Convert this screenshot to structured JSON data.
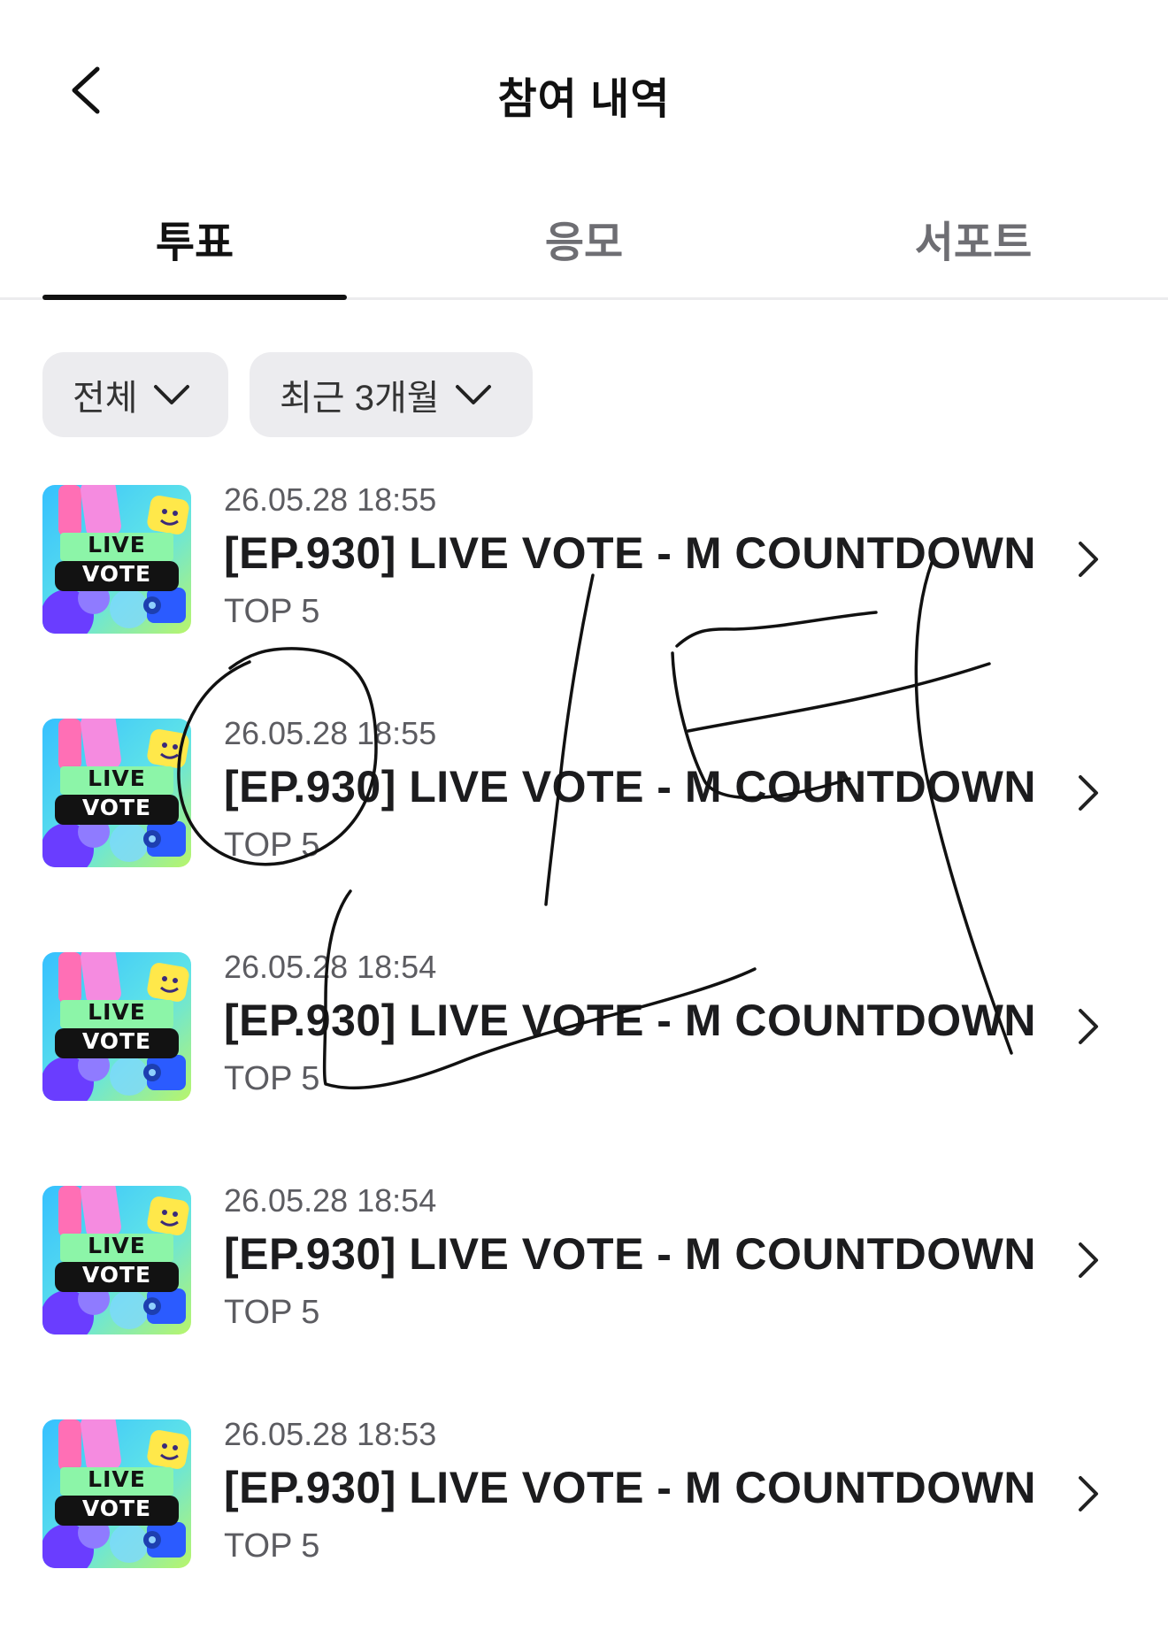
{
  "header": {
    "title": "참여 내역",
    "back_icon": "chevron-left-icon"
  },
  "tabs": [
    {
      "label": "투표",
      "active": true
    },
    {
      "label": "응모",
      "active": false
    },
    {
      "label": "서포트",
      "active": false
    }
  ],
  "filters": [
    {
      "label": "전체",
      "icon": "chevron-down-icon"
    },
    {
      "label": "최근 3개월",
      "icon": "chevron-down-icon"
    }
  ],
  "thumbnail": {
    "line1": "LIVE",
    "line2": "VOTE"
  },
  "items": [
    {
      "date": "26.05.28 18:55",
      "title": "[EP.930] LIVE VOTE - M COUNTDOWN",
      "rank": "TOP 5"
    },
    {
      "date": "26.05.28 18:55",
      "title": "[EP.930] LIVE VOTE - M COUNTDOWN",
      "rank": "TOP 5"
    },
    {
      "date": "26.05.28 18:54",
      "title": "[EP.930] LIVE VOTE - M COUNTDOWN",
      "rank": "TOP 5"
    },
    {
      "date": "26.05.28 18:54",
      "title": "[EP.930] LIVE VOTE - M COUNTDOWN",
      "rank": "TOP 5"
    },
    {
      "date": "26.05.28 18:53",
      "title": "[EP.930] LIVE VOTE - M COUNTDOWN",
      "rank": "TOP 5"
    }
  ],
  "colors": {
    "accent": "#111111",
    "chip_bg": "#ececef",
    "muted_text": "#5c5c61"
  }
}
